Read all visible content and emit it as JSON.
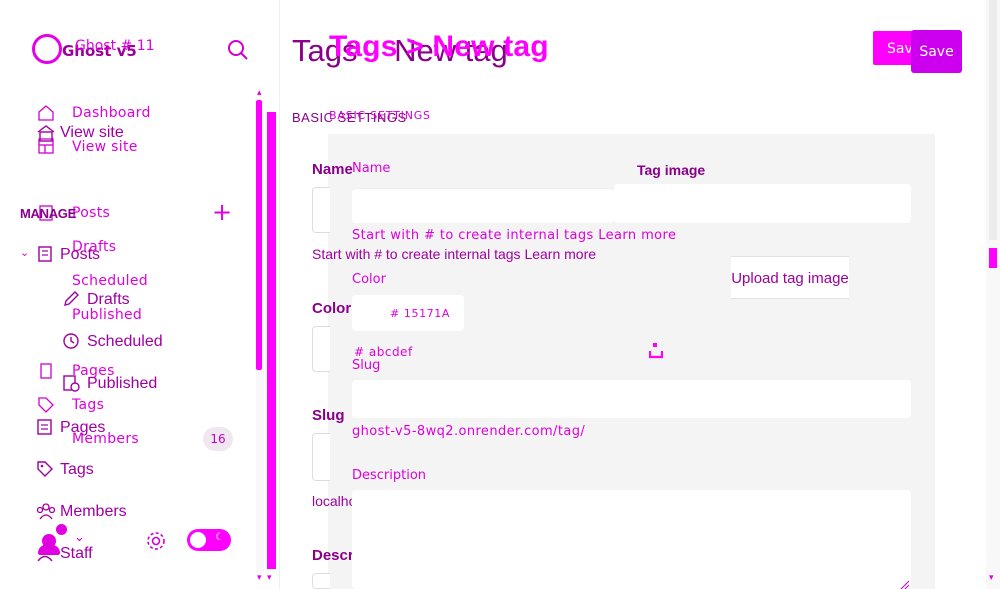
{
  "sidebar": {
    "brand_name_a": "Ghost v5",
    "brand_name_b": "Ghost # 11",
    "nav_a": {
      "dashboard": "Dashboard",
      "view_site": "View site",
      "posts": "Posts",
      "drafts": "Drafts",
      "scheduled": "Scheduled",
      "published": "Published",
      "pages": "Pages",
      "tags": "Tags",
      "members": "Members",
      "members_count": "16"
    },
    "nav_b": {
      "view_site": "View site",
      "manage": "MANAGE",
      "posts": "Posts",
      "drafts": "Drafts",
      "scheduled": "Scheduled",
      "published": "Published",
      "pages": "Pages",
      "tags": "Tags",
      "members": "Members",
      "staff": "Staff"
    }
  },
  "header": {
    "title_a": "Tags > New tag",
    "title_b_section": "Tags",
    "title_b_sep": "›",
    "title_b_page": "New tag",
    "save_a": "Save",
    "save_b": "Save"
  },
  "form": {
    "section_a": "BASIC SETTINGS",
    "section_b": "BASIC SETTINGS",
    "name_label_a": "Name",
    "name_label_b": "Name",
    "name_hint_a": "Start with # to create internal tags Learn more",
    "name_hint_b": "Start with # to create internal tags Learn more",
    "tag_image_label": "Tag image",
    "upload_label": "Upload tag image",
    "color_label_a": "Color",
    "color_label_b": "Color",
    "color_value": "# 15171A",
    "color_placeholder": "# abcdef",
    "slug_label_a": "Slug",
    "slug_label_b": "Slug",
    "slug_url_a": "localhost:2368/tag/",
    "slug_url_b": "ghost-v5-8wq2.onrender.com/tag/",
    "description_label_a": "Description",
    "description_label_b": "Description"
  },
  "colors": {
    "accent": "#ff00ff",
    "accent_dark": "#8a008a",
    "panel_bg": "#f4f4f4"
  }
}
